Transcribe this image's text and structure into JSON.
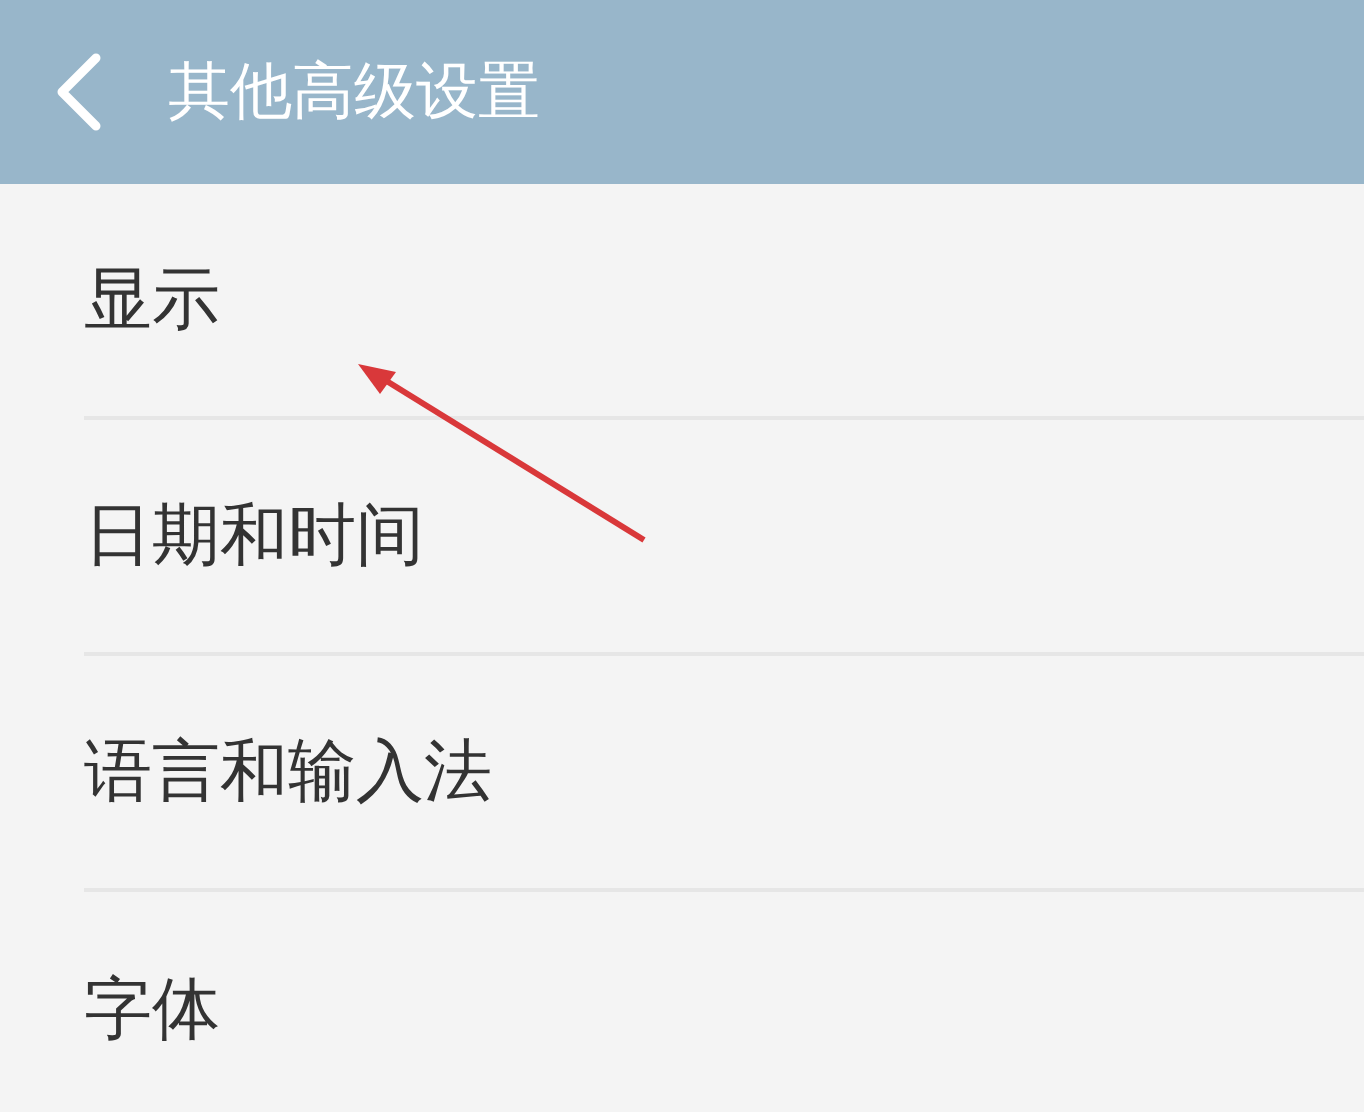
{
  "header": {
    "title": "其他高级设置"
  },
  "items": [
    {
      "label": "显示"
    },
    {
      "label": "日期和时间"
    },
    {
      "label": "语言和输入法"
    },
    {
      "label": "字体"
    }
  ]
}
